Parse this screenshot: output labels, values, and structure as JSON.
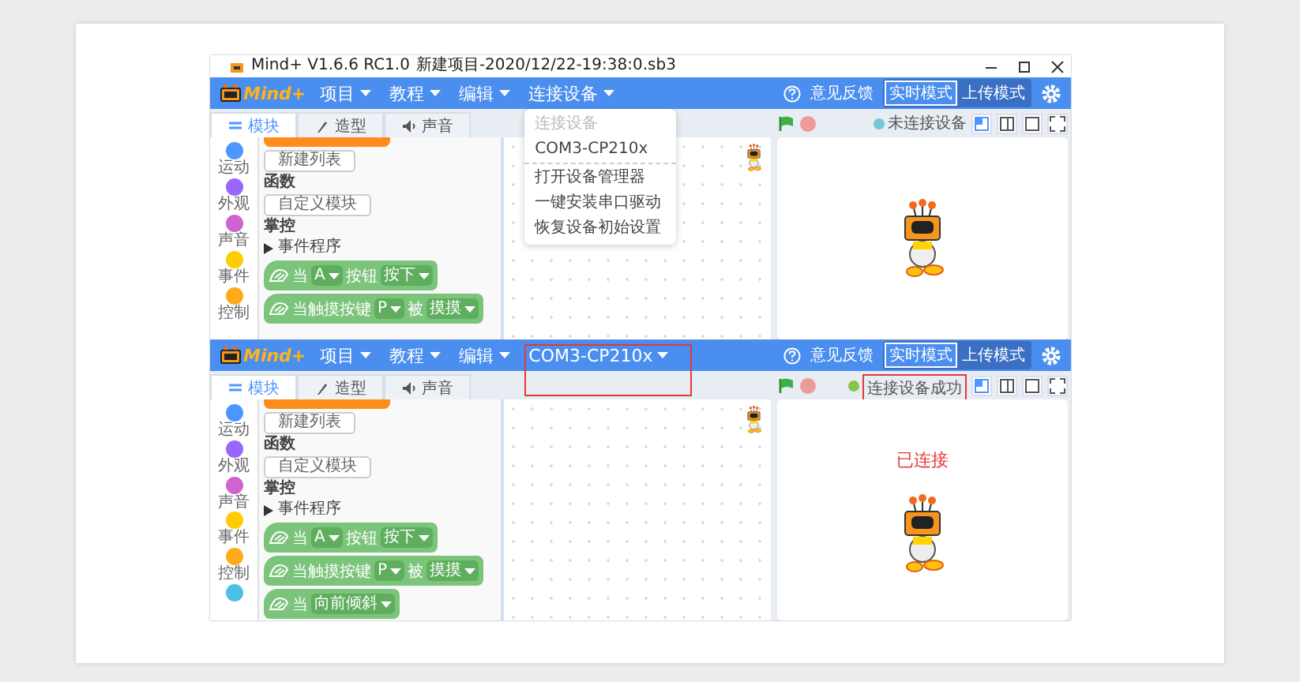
{
  "screens": [
    {
      "title_bar": {
        "app_title": "Mind+ V1.6.6 RC1.0",
        "project": "新建项目-2020/12/22-19:38:0.sb3"
      },
      "logo": "Mind+",
      "menu": [
        {
          "label": "项目",
          "highlighted": false
        },
        {
          "label": "教程",
          "highlighted": false
        },
        {
          "label": "编辑",
          "highlighted": false
        },
        {
          "label": "连接设备",
          "highlighted": false,
          "dropdown": [
            {
              "label": "连接设备",
              "disabled": true,
              "separator": false
            },
            {
              "label": "COM3-CP210x",
              "disabled": false,
              "separator": true
            },
            {
              "label": "打开设备管理器",
              "disabled": false,
              "separator": false
            },
            {
              "label": "一键安装串口驱动",
              "disabled": false,
              "separator": false
            },
            {
              "label": "恢复设备初始设置",
              "disabled": false,
              "separator": false
            }
          ]
        }
      ],
      "feedback": "意见反馈",
      "modes": [
        {
          "label": "实时模式",
          "selected": true
        },
        {
          "label": "上传模式",
          "selected": false
        }
      ],
      "tabs": [
        {
          "label": "模块",
          "selected": true
        },
        {
          "label": "造型",
          "selected": false
        },
        {
          "label": "声音",
          "selected": false
        }
      ],
      "device": {
        "label": "未连接设备",
        "connected": false,
        "highlighted": false
      },
      "categories": [
        {
          "label": "运动",
          "color": "#4c97ff"
        },
        {
          "label": "外观",
          "color": "#9966ff"
        },
        {
          "label": "声音",
          "color": "#cf63cf"
        },
        {
          "label": "事件",
          "color": "#ffcc00"
        },
        {
          "label": "控制",
          "color": "#ffab19"
        }
      ],
      "palette": [
        {
          "kind": "button",
          "label": "新建列表"
        },
        {
          "kind": "heading",
          "label": "函数"
        },
        {
          "kind": "button",
          "label": "自定义模块"
        },
        {
          "kind": "heading",
          "label": "掌控"
        },
        {
          "kind": "group",
          "label": "事件程序"
        },
        {
          "kind": "block",
          "parts": [
            {
              "kind": "text",
              "label": "当"
            },
            {
              "kind": "dropdown",
              "label": "A"
            },
            {
              "kind": "text",
              "label": "按钮"
            },
            {
              "kind": "dropdown",
              "label": "按下"
            }
          ]
        },
        {
          "kind": "block",
          "parts": [
            {
              "kind": "text",
              "label": "当触摸按键"
            },
            {
              "kind": "dropdown",
              "label": "P"
            },
            {
              "kind": "text",
              "label": "被"
            },
            {
              "kind": "dropdown",
              "label": "摸摸"
            }
          ]
        }
      ]
    },
    {
      "logo": "Mind+",
      "menu": [
        {
          "label": "项目",
          "highlighted": false
        },
        {
          "label": "教程",
          "highlighted": false
        },
        {
          "label": "编辑",
          "highlighted": false
        },
        {
          "label": "COM3-CP210x",
          "highlighted": true
        }
      ],
      "feedback": "意见反馈",
      "modes": [
        {
          "label": "实时模式",
          "selected": true
        },
        {
          "label": "上传模式",
          "selected": false
        }
      ],
      "tabs": [
        {
          "label": "模块",
          "selected": true
        },
        {
          "label": "造型",
          "selected": false
        },
        {
          "label": "声音",
          "selected": false
        }
      ],
      "device": {
        "label": "连接设备成功",
        "connected": true,
        "highlighted": true
      },
      "stage_note": "已连接",
      "categories": [
        {
          "label": "运动",
          "color": "#4c97ff"
        },
        {
          "label": "外观",
          "color": "#9966ff"
        },
        {
          "label": "声音",
          "color": "#cf63cf"
        },
        {
          "label": "事件",
          "color": "#ffcc00"
        },
        {
          "label": "控制",
          "color": "#ffab19"
        },
        {
          "color": "#4cbfe6"
        }
      ],
      "palette": [
        {
          "kind": "button",
          "label": "新建列表"
        },
        {
          "kind": "heading",
          "label": "函数"
        },
        {
          "kind": "button",
          "label": "自定义模块"
        },
        {
          "kind": "heading",
          "label": "掌控"
        },
        {
          "kind": "group",
          "label": "事件程序"
        },
        {
          "kind": "block",
          "parts": [
            {
              "kind": "text",
              "label": "当"
            },
            {
              "kind": "dropdown",
              "label": "A"
            },
            {
              "kind": "text",
              "label": "按钮"
            },
            {
              "kind": "dropdown",
              "label": "按下"
            }
          ]
        },
        {
          "kind": "block",
          "parts": [
            {
              "kind": "text",
              "label": "当触摸按键"
            },
            {
              "kind": "dropdown",
              "label": "P"
            },
            {
              "kind": "text",
              "label": "被"
            },
            {
              "kind": "dropdown",
              "label": "摸摸"
            }
          ]
        },
        {
          "kind": "block",
          "parts": [
            {
              "kind": "text",
              "label": "当"
            },
            {
              "kind": "dropdown",
              "label": "向前倾斜"
            }
          ]
        }
      ]
    }
  ]
}
